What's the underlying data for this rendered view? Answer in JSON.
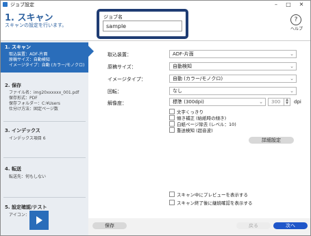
{
  "window": {
    "title": "ジョブ設定"
  },
  "header": {
    "step_title": "1. スキャン",
    "step_subtitle": "スキャンの設定を行います。",
    "job_name_label": "ジョブ名",
    "job_name_value": "sample",
    "help_label": "ヘルプ"
  },
  "sidebar": {
    "sections": [
      {
        "title": "1. スキャン",
        "lines": [
          "取込装置：ADF-片面",
          "原稿サイズ：自動検知",
          "イメージタイプ：自動 (カラー/モノクロ)"
        ],
        "active": true
      },
      {
        "title": "2. 保存",
        "lines": [
          "ファイル名：img20xxxxxx_001.pdf",
          "保存形式：PDF",
          "保存フォルダー：C:¥Users",
          "仕分け方法：固定ページ数"
        ]
      },
      {
        "title": "3. インデックス",
        "lines": [
          "インデックス項目 6"
        ]
      },
      {
        "title": "4. 転送",
        "lines": [
          "転送先：何もしない"
        ]
      },
      {
        "title": "5. 設定確認/テスト",
        "lines": [
          "アイコン："
        ]
      }
    ],
    "icon_name": "play-icon"
  },
  "main": {
    "fields": [
      {
        "label": "取込装置：",
        "value": "ADF-片面"
      },
      {
        "label": "原稿サイズ：",
        "value": "自動検知"
      },
      {
        "label": "イメージタイプ：",
        "value": "自動 (カラー/モノクロ)"
      },
      {
        "label": "回転：",
        "value": "なし"
      },
      {
        "label": "解像度：",
        "value": "標準 (300dpi)",
        "number": "300",
        "unit": "dpi"
      }
    ],
    "checkboxes": [
      "文字くっきり",
      "傾き補正 (給紙時の傾き)",
      "白紙ページ除去 (レベル：10)",
      "重送検知 (超音波)"
    ],
    "detail_button": "詳細設定",
    "bottom_checkboxes": [
      "スキャン中にプレビューを表示する",
      "スキャン終了後に継続確認を表示する"
    ]
  },
  "footer": {
    "save_label": "保存",
    "back_label": "戻る",
    "next_label": "次へ"
  },
  "colors": {
    "accent": "#2a6dba",
    "primary_button": "#1f56c9",
    "highlight_border": "#1f3c73"
  }
}
